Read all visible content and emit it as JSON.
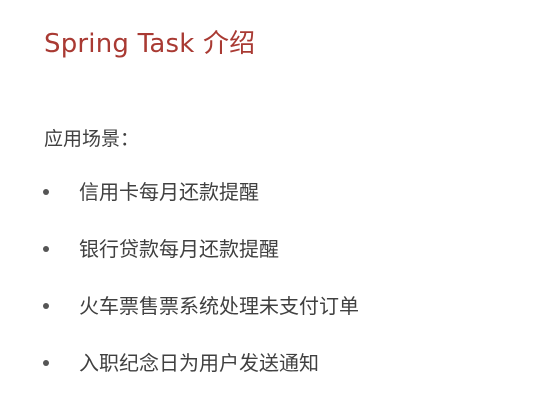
{
  "slide": {
    "title": "Spring Task 介绍",
    "section_heading": "应用场景：",
    "bullets": [
      "信用卡每月还款提醒",
      "银行贷款每月还款提醒",
      "火车票售票系统处理未支付订单",
      "入职纪念日为用户发送通知"
    ]
  },
  "colors": {
    "title": "#a93a33",
    "body_text": "#404040",
    "background": "#ffffff"
  }
}
